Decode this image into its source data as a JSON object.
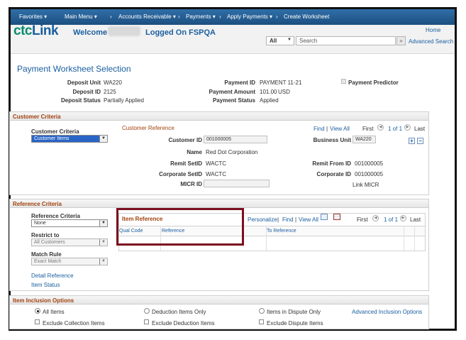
{
  "nav": {
    "favorites": "Favorites ▾",
    "main_menu": "Main Menu ▾",
    "accounts_receivable": "Accounts Receivable ▾",
    "payments": "Payments ▾",
    "apply_payments": "Apply Payments ▾",
    "create_worksheet": "Create Worksheet",
    "sep": "›"
  },
  "header": {
    "logo_a": "ctc",
    "logo_b": "Link",
    "welcome": "Welcome",
    "logged_on": "Logged On FSPQA",
    "home": "Home",
    "search_scope": "All",
    "search_placeholder": "Search",
    "search_go": "»",
    "advanced_search": "Advanced Search"
  },
  "page_title": "Payment Worksheet Selection",
  "summary": {
    "deposit_unit_label": "Deposit Unit",
    "deposit_unit": "WA220",
    "deposit_id_label": "Deposit ID",
    "deposit_id": "2125",
    "deposit_status_label": "Deposit Status",
    "deposit_status": "Partially Applied",
    "payment_id_label": "Payment ID",
    "payment_id": "PAYMENT 11-21",
    "payment_amount_label": "Payment Amount",
    "payment_amount": "101.00",
    "payment_currency": "USD",
    "payment_status_label": "Payment Status",
    "payment_status": "Applied",
    "payment_predictor_label": "Payment Predictor"
  },
  "customer_criteria": {
    "section_title": "Customer Criteria",
    "criteria_label": "Customer Criteria",
    "criteria_value": "Customer Items",
    "ref_title": "Customer Reference",
    "find": "Find",
    "view_all": "View All",
    "first": "First",
    "pager": "1 of 1",
    "last": "Last",
    "customer_id_label": "Customer ID",
    "customer_id": "001000005",
    "business_unit_label": "Business Unit",
    "business_unit": "WA220",
    "name_label": "Name",
    "name": "Red Dot Corporation",
    "remit_setid_label": "Remit SetID",
    "remit_setid": "WACTC",
    "remit_from_id_label": "Remit From ID",
    "remit_from_id": "001000005",
    "corporate_setid_label": "Corporate SetID",
    "corporate_setid": "WACTC",
    "corporate_id_label": "Corporate ID",
    "corporate_id": "001000005",
    "micr_id_label": "MICR ID",
    "micr_id": "",
    "link_micr": "Link MICR",
    "add": "+",
    "remove": "−"
  },
  "reference_criteria": {
    "section_title": "Reference Criteria",
    "criteria_label": "Reference Criteria",
    "criteria_value": "None",
    "restrict_label": "Restrict to",
    "restrict_value": "All Customers",
    "match_label": "Match Rule",
    "match_value": "Exact Match",
    "detail_reference": "Detail Reference",
    "item_status": "Item Status",
    "grid_title": "Item Reference",
    "personalize": "Personalize",
    "find": "Find",
    "view_all": "View All",
    "first": "First",
    "pager": "1 of 1",
    "last": "Last",
    "col_qual_code": "Qual Code",
    "col_reference": "Reference",
    "col_to_reference": "To Reference"
  },
  "inclusion": {
    "section_title": "Item Inclusion Options",
    "all_items": "All Items",
    "deduction_items_only": "Deduction Items Only",
    "items_in_dispute_only": "Items in Dispute Only",
    "advanced_inclusion": "Advanced Inclusion Options",
    "exclude_collection": "Exclude Collection Items",
    "exclude_deduction": "Exclude Deduction Items",
    "exclude_dispute": "Exclude Dispute Items"
  },
  "colors": {
    "nav_bg": "#1d4f80",
    "link": "#1b5fa0",
    "section_title": "#a0410d",
    "highlight": "#7b0f1e"
  }
}
